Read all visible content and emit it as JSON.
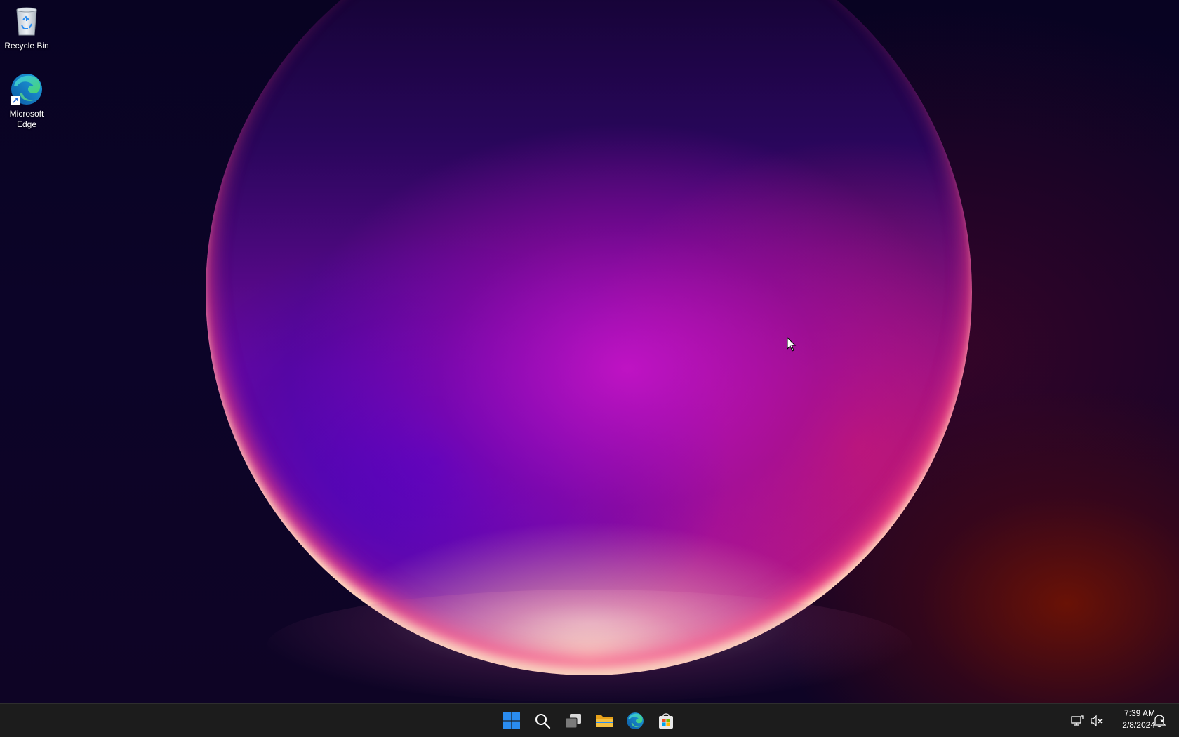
{
  "desktop": {
    "icons": [
      {
        "label": "Recycle Bin",
        "icon": "recycle-bin-icon"
      },
      {
        "label": "Microsoft Edge",
        "icon": "edge-icon"
      }
    ]
  },
  "taskbar": {
    "pinned": [
      {
        "name": "Start",
        "icon": "windows-start-icon"
      },
      {
        "name": "Search",
        "icon": "search-icon"
      },
      {
        "name": "Task View",
        "icon": "task-view-icon"
      },
      {
        "name": "File Explorer",
        "icon": "folder-icon"
      },
      {
        "name": "Microsoft Edge",
        "icon": "edge-icon"
      },
      {
        "name": "Microsoft Store",
        "icon": "store-icon"
      }
    ],
    "tray": {
      "icons": [
        "network-icon",
        "volume-muted-icon"
      ],
      "time": "7:39 AM",
      "date": "2/8/2024",
      "notification_icon": "notification-bell-icon"
    }
  },
  "colors": {
    "taskbar_bg": "#1c1c1c",
    "start_blue": "#2a8cf0",
    "folder_yellow": "#f5c040"
  }
}
